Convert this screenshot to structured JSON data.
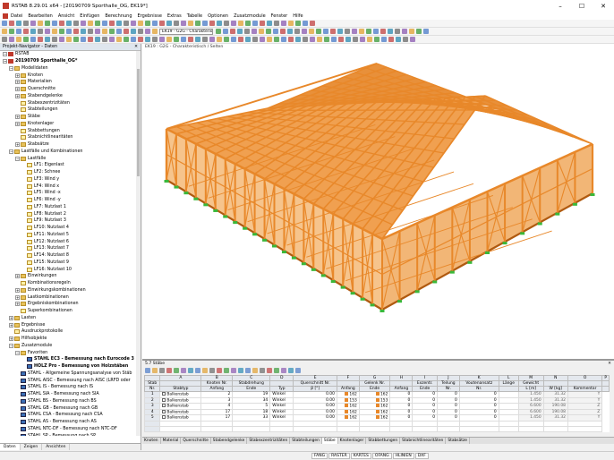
{
  "window": {
    "title": "RSTAB 8.29.01 x64 - [20190709 Sporthalle_OG, EK19*]",
    "minimize": "–",
    "maximize": "☐",
    "close": "✕"
  },
  "menu": [
    "Datei",
    "Bearbeiten",
    "Ansicht",
    "Einfügen",
    "Berechnung",
    "Ergebnisse",
    "Extras",
    "Tabelle",
    "Optionen",
    "Zusatzmodule",
    "Fenster",
    "Hilfe"
  ],
  "toolbar": {
    "load_case_combo": "EK19 - G2G - Charakteristis"
  },
  "navigator": {
    "title": "Projekt-Navigator - Daten",
    "tree": [
      {
        "d": 0,
        "e": "−",
        "i": "root",
        "t": "RSTAB"
      },
      {
        "d": 0,
        "e": "−",
        "i": "root",
        "t": "20190709 Sporthalle_OG*",
        "b": true
      },
      {
        "d": 1,
        "e": "−",
        "i": "folder",
        "t": "Modelldaten"
      },
      {
        "d": 2,
        "e": "+",
        "i": "folder",
        "t": "Knoten"
      },
      {
        "d": 2,
        "e": "+",
        "i": "folder",
        "t": "Materialien"
      },
      {
        "d": 2,
        "e": "+",
        "i": "folder",
        "t": "Querschnitte"
      },
      {
        "d": 2,
        "e": "+",
        "i": "folder",
        "t": "Stabendgelenke"
      },
      {
        "d": 2,
        "e": "",
        "i": "file",
        "t": "Stabexzentrizitäten"
      },
      {
        "d": 2,
        "e": "",
        "i": "file",
        "t": "Stabteilungen"
      },
      {
        "d": 2,
        "e": "+",
        "i": "folder",
        "t": "Stäbe"
      },
      {
        "d": 2,
        "e": "+",
        "i": "folder",
        "t": "Knotenlager"
      },
      {
        "d": 2,
        "e": "",
        "i": "file",
        "t": "Stabbettungen"
      },
      {
        "d": 2,
        "e": "",
        "i": "file",
        "t": "Stabnichtlinearitäten"
      },
      {
        "d": 2,
        "e": "+",
        "i": "folder",
        "t": "Stabsätze"
      },
      {
        "d": 1,
        "e": "−",
        "i": "folder",
        "t": "Lastfälle und Kombinationen"
      },
      {
        "d": 2,
        "e": "−",
        "i": "folder",
        "t": "Lastfälle"
      },
      {
        "d": 3,
        "e": "",
        "i": "file",
        "t": "LF1: Eigenlast"
      },
      {
        "d": 3,
        "e": "",
        "i": "file",
        "t": "LF2: Schnee"
      },
      {
        "d": 3,
        "e": "",
        "i": "file",
        "t": "LF3: Wind y"
      },
      {
        "d": 3,
        "e": "",
        "i": "file",
        "t": "LF4: Wind x"
      },
      {
        "d": 3,
        "e": "",
        "i": "file",
        "t": "LF5: Wind -x"
      },
      {
        "d": 3,
        "e": "",
        "i": "file",
        "t": "LF6: Wind -y"
      },
      {
        "d": 3,
        "e": "",
        "i": "file",
        "t": "LF7: Nutzlast 1"
      },
      {
        "d": 3,
        "e": "",
        "i": "file",
        "t": "LF8: Nutzlast 2"
      },
      {
        "d": 3,
        "e": "",
        "i": "file",
        "t": "LF9: Nutzlast 3"
      },
      {
        "d": 3,
        "e": "",
        "i": "file",
        "t": "LF10: Nutzlast 4"
      },
      {
        "d": 3,
        "e": "",
        "i": "file",
        "t": "LF11: Nutzlast 5"
      },
      {
        "d": 3,
        "e": "",
        "i": "file",
        "t": "LF12: Nutzlast 6"
      },
      {
        "d": 3,
        "e": "",
        "i": "file",
        "t": "LF13: Nutzlast 7"
      },
      {
        "d": 3,
        "e": "",
        "i": "file",
        "t": "LF14: Nutzlast 8"
      },
      {
        "d": 3,
        "e": "",
        "i": "file",
        "t": "LF15: Nutzlast 9"
      },
      {
        "d": 3,
        "e": "",
        "i": "file",
        "t": "LF16: Nutzlast 10"
      },
      {
        "d": 2,
        "e": "+",
        "i": "folder",
        "t": "Einwirkungen"
      },
      {
        "d": 2,
        "e": "",
        "i": "file",
        "t": "Kombinationsregeln"
      },
      {
        "d": 2,
        "e": "+",
        "i": "folder",
        "t": "Einwirkungskombinationen"
      },
      {
        "d": 2,
        "e": "+",
        "i": "folder",
        "t": "Lastkombinationen"
      },
      {
        "d": 2,
        "e": "+",
        "i": "folder",
        "t": "Ergebniskombinationen"
      },
      {
        "d": 2,
        "e": "",
        "i": "file",
        "t": "Superkombinationen"
      },
      {
        "d": 1,
        "e": "+",
        "i": "folder",
        "t": "Lasten"
      },
      {
        "d": 1,
        "e": "+",
        "i": "folder",
        "t": "Ergebnisse"
      },
      {
        "d": 1,
        "e": "",
        "i": "file",
        "t": "Ausdruckprotokolle"
      },
      {
        "d": 1,
        "e": "+",
        "i": "folder",
        "t": "Hilfsobjekte"
      },
      {
        "d": 1,
        "e": "−",
        "i": "folder",
        "t": "Zusatzmodule"
      },
      {
        "d": 2,
        "e": "−",
        "i": "folder",
        "t": "Favoriten"
      },
      {
        "d": 3,
        "e": "",
        "i": "mod",
        "t": "STAHL EC3 - Bemessung nach Eurocode 3",
        "b": true
      },
      {
        "d": 3,
        "e": "",
        "i": "mod",
        "t": "HOLZ Pro - Bemessung von Holzstäben",
        "b": true
      },
      {
        "d": 2,
        "e": "",
        "i": "mod",
        "t": "STAHL - Allgemeine Spannungsanalyse von Stäb"
      },
      {
        "d": 2,
        "e": "",
        "i": "mod",
        "t": "STAHL AISC - Bemessung nach AISC (LRFD oder"
      },
      {
        "d": 2,
        "e": "",
        "i": "mod",
        "t": "STAHL IS - Bemessung nach IS"
      },
      {
        "d": 2,
        "e": "",
        "i": "mod",
        "t": "STAHL SIA - Bemessung nach SIA"
      },
      {
        "d": 2,
        "e": "",
        "i": "mod",
        "t": "STAHL BS - Bemessung nach BS"
      },
      {
        "d": 2,
        "e": "",
        "i": "mod",
        "t": "STAHL GB - Bemessung nach GB"
      },
      {
        "d": 2,
        "e": "",
        "i": "mod",
        "t": "STAHL CSA - Bemessung nach CSA"
      },
      {
        "d": 2,
        "e": "",
        "i": "mod",
        "t": "STAHL AS - Bemessung nach AS"
      },
      {
        "d": 2,
        "e": "",
        "i": "mod",
        "t": "STAHL NTC-DF - Bemessung nach NTC-DF"
      },
      {
        "d": 2,
        "e": "",
        "i": "mod",
        "t": "STAHL SP - Bemessung nach SP"
      }
    ],
    "tabs": [
      "Daten",
      "Zeigen",
      "Ansichten"
    ]
  },
  "view": {
    "tab": "EK19 : G2G - Charakteristisch / Selten"
  },
  "panel": {
    "title": "5.7 Stäbe",
    "col_letters": [
      "A",
      "B",
      "C",
      "D",
      "E",
      "F",
      "G",
      "H",
      "I",
      "J",
      "K",
      "L",
      "M",
      "N",
      "O",
      "P"
    ],
    "header1": [
      "Stab",
      "",
      "Knoten Nr.",
      "Stabdrehung",
      "",
      "Querschnitt Nr.",
      "",
      "Gelenk Nr.",
      "",
      "Exzentr.",
      "Teilung",
      "Voutenansatz",
      "Länge",
      "Gewicht",
      "",
      ""
    ],
    "header2": [
      "Nr.",
      "Stabtyp",
      "Anfang",
      "Ende",
      "Typ",
      "β [°]",
      "Anfang",
      "Ende",
      "Anfang",
      "Ende",
      "Nr.",
      "Nr.",
      "",
      "L [m]",
      "W [kg]",
      "Kommentar"
    ],
    "rows": [
      [
        "1",
        "Balkenstab",
        "2",
        "19",
        "Winkel",
        "0.00",
        "162",
        "162",
        "0",
        "0",
        "0",
        "0",
        "",
        "1.450",
        "31.32",
        "Y"
      ],
      [
        "2",
        "Balkenstab",
        "3",
        "34",
        "Winkel",
        "0.00",
        "153",
        "153",
        "0",
        "0",
        "0",
        "0",
        "",
        "1.450",
        "31.32",
        "Y"
      ],
      [
        "3",
        "Balkenstab",
        "4",
        "5",
        "Winkel",
        "0.00",
        "162",
        "162",
        "0",
        "0",
        "0",
        "0",
        "",
        "6.600",
        "190.08",
        "Z"
      ],
      [
        "4",
        "Balkenstab",
        "17",
        "18",
        "Winkel",
        "0.00",
        "162",
        "162",
        "0",
        "0",
        "0",
        "0",
        "",
        "6.600",
        "190.08",
        "Z"
      ],
      [
        "5",
        "Balkenstab",
        "17",
        "33",
        "Winkel",
        "0.00",
        "162",
        "162",
        "0",
        "0",
        "0",
        "0",
        "",
        "1.450",
        "31.32",
        "Y"
      ]
    ],
    "sheet_tabs": [
      "Knoten",
      "Material",
      "Querschnitte",
      "Stabendgelenke",
      "Stabexzentrizitäten",
      "Stabteilungen",
      "Stäbe",
      "Knotenlager",
      "Stabbettungen",
      "Stabnichtlinearitäten",
      "Stabsätze"
    ],
    "active_tab": "Stäbe"
  },
  "status": [
    "FANG",
    "RASTER",
    "KARTES",
    "OFANG",
    "HLINIEN",
    "DXF"
  ],
  "colors": {
    "timber": "#e8882a",
    "timber_dark": "#b05a10",
    "support": "#3ab83a",
    "nav_title": "#dfe6ee"
  }
}
